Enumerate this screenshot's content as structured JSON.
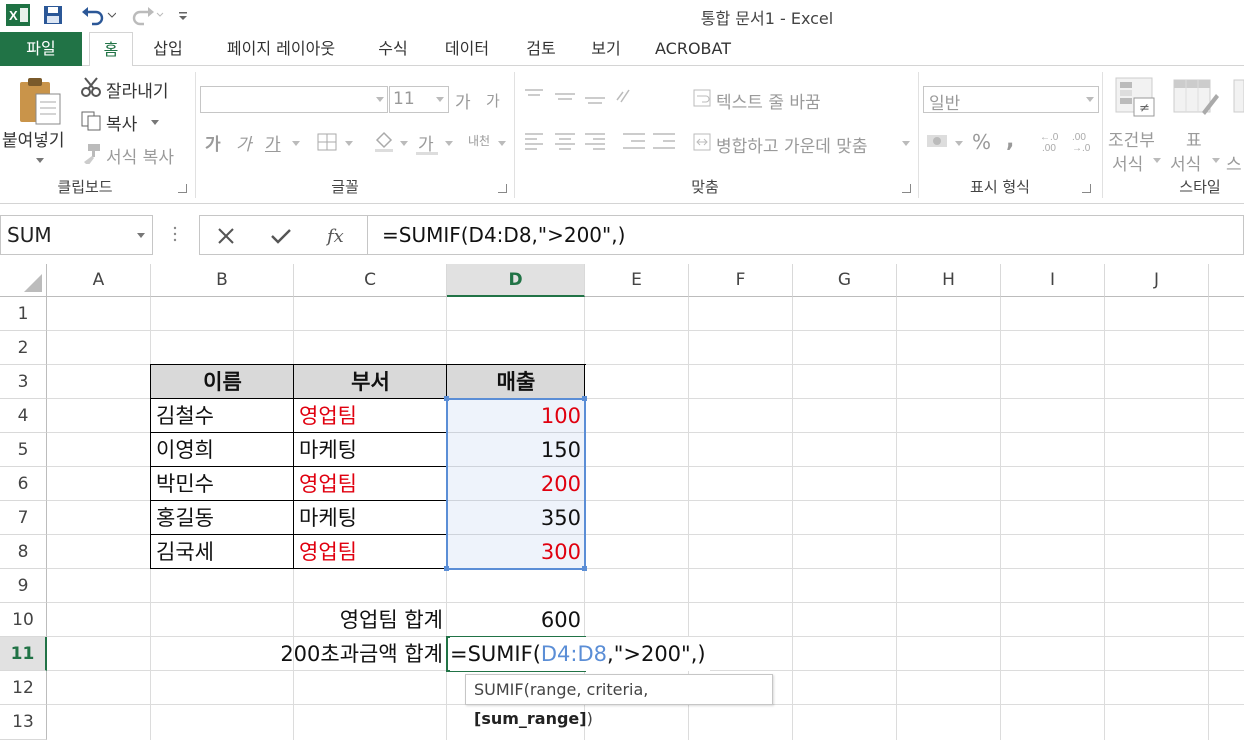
{
  "window": {
    "title": "통합 문서1 - Excel"
  },
  "tabs": [
    {
      "label": "파일"
    },
    {
      "label": "홈"
    },
    {
      "label": "삽입"
    },
    {
      "label": "페이지 레이아웃"
    },
    {
      "label": "수식"
    },
    {
      "label": "데이터"
    },
    {
      "label": "검토"
    },
    {
      "label": "보기"
    },
    {
      "label": "ACROBAT"
    }
  ],
  "ribbon": {
    "clipboard": {
      "paste": "붙여넣기",
      "cut": "잘라내기",
      "copy": "복사",
      "format_painter": "서식 복사",
      "group": "클립보드"
    },
    "font": {
      "size": "11",
      "bold": "가",
      "italic": "가",
      "underline": "가",
      "font_color": "가",
      "phonetic": "내천",
      "grow": "가",
      "shrink": "가",
      "group": "글꼴"
    },
    "alignment": {
      "wrap": "텍스트 줄 바꿈",
      "merge": "병합하고 가운데 맞춤",
      "group": "맞춤"
    },
    "number": {
      "format": "일반",
      "percent": "%",
      "comma": ",",
      "group": "표시 형식"
    },
    "styles": {
      "conditional_line1": "조건부",
      "conditional_line2": "서식",
      "table_line1": "표",
      "table_line2": "서식",
      "cell_styles": "스",
      "group": "스타일"
    }
  },
  "formula_bar": {
    "name_box": "SUM",
    "formula": "=SUMIF(D4:D8,\">200\",)"
  },
  "columns": [
    "A",
    "B",
    "C",
    "D",
    "E",
    "F",
    "G",
    "H",
    "I",
    "J"
  ],
  "rows": [
    "1",
    "2",
    "3",
    "4",
    "5",
    "6",
    "7",
    "8",
    "9",
    "10",
    "11",
    "12",
    "13"
  ],
  "table": {
    "headers": [
      "이름",
      "부서",
      "매출"
    ],
    "rows": [
      {
        "name": "김철수",
        "dept": "영업팀",
        "sales": "100"
      },
      {
        "name": "이영희",
        "dept": "마케팅",
        "sales": "150"
      },
      {
        "name": "박민수",
        "dept": "영업팀",
        "sales": "200"
      },
      {
        "name": "홍길동",
        "dept": "마케팅",
        "sales": "350"
      },
      {
        "name": "김국세",
        "dept": "영업팀",
        "sales": "300"
      }
    ]
  },
  "summary": {
    "sales_team_label": "영업팀 합계",
    "sales_team_value": "600",
    "over200_label": "200초과금액 합계",
    "editing_prefix": "=SUMIF(",
    "editing_ref": "D4:D8",
    "editing_suffix": ",\">200\",)"
  },
  "tooltip": {
    "prefix": "SUMIF(range, criteria, ",
    "bold": "[sum_range]",
    "suffix": ")"
  },
  "colors": {
    "accent": "#217346",
    "red_text": "#e0000f",
    "range_highlight": "#5b8ed6"
  }
}
